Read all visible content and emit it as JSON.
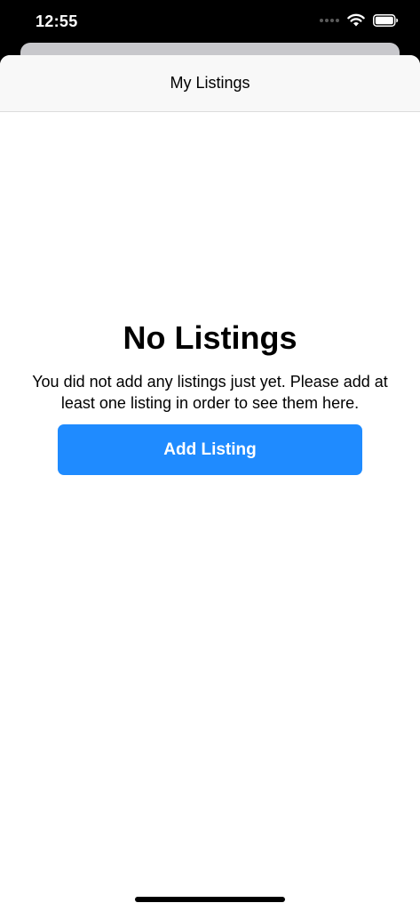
{
  "status_bar": {
    "time": "12:55"
  },
  "nav": {
    "title": "My Listings"
  },
  "empty_state": {
    "title": "No Listings",
    "message": "You did not add any listings just yet. Please add at least one listing in order to see them here.",
    "button_label": "Add Listing"
  },
  "colors": {
    "accent": "#1f8bff",
    "nav_background": "#f8f8f8",
    "background": "#ffffff"
  },
  "icons": [
    "signal-dots-icon",
    "wifi-icon",
    "battery-icon"
  ]
}
